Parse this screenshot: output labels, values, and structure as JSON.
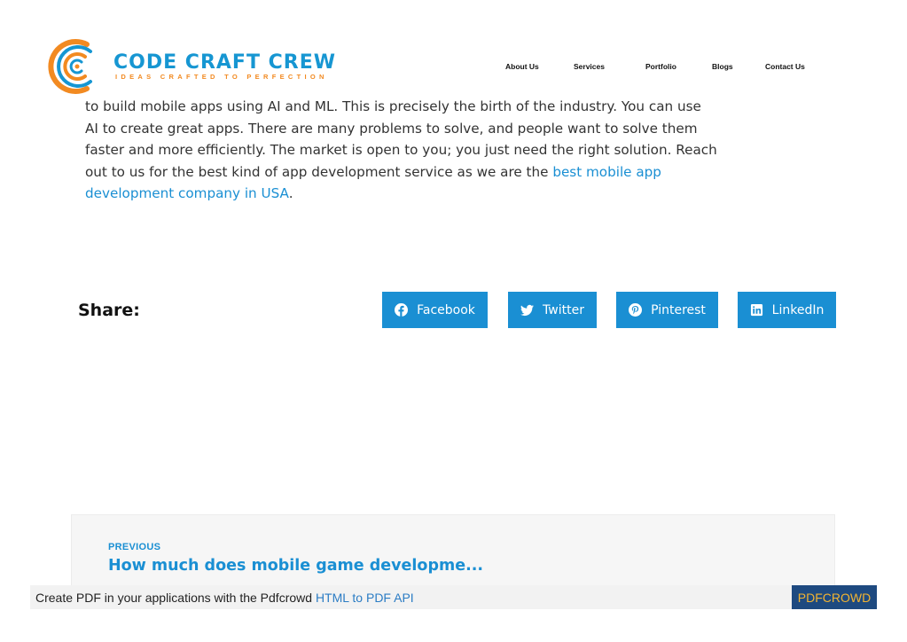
{
  "header": {
    "brand_name": "CODE CRAFT CREW",
    "brand_tagline": "IDEAS CRAFTED TO PERFECTION",
    "nav": [
      {
        "label": "About Us"
      },
      {
        "label": "Services"
      },
      {
        "label": "Portfolio"
      },
      {
        "label": "Blogs"
      },
      {
        "label": "Contact Us"
      }
    ]
  },
  "article": {
    "line1": "to build mobile apps using AI and ML. This is precisely the birth of the industry. You can use",
    "line2": "AI to create great apps. There are many problems to solve, and people want to solve them",
    "line3": "faster and more efficiently. The market is open to you; you just need the right solution. Reach",
    "line4_text": "out to us for the best kind of app development service as we are the ",
    "link_part1": "best mobile app",
    "link_part2": "development company in USA",
    "line5_end": "."
  },
  "share": {
    "label": "Share:",
    "buttons": [
      {
        "label": "Facebook",
        "icon": "facebook-icon"
      },
      {
        "label": "Twitter",
        "icon": "twitter-icon"
      },
      {
        "label": "Pinterest",
        "icon": "pinterest-icon"
      },
      {
        "label": "LinkedIn",
        "icon": "linkedin-icon"
      }
    ]
  },
  "post_nav": {
    "previous_label": "PREVIOUS",
    "previous_title": "How much does mobile game developme..."
  },
  "pdf_footer": {
    "text": "Create PDF in your applications with the Pdfcrowd ",
    "link": "HTML to PDF API",
    "brand": "PDFCROWD"
  },
  "colors": {
    "accent_blue": "#1a8fd3",
    "brand_orange": "#f28a21",
    "pdf_brand_bg": "#1e4a80",
    "pdf_brand_text": "#f3b431"
  }
}
